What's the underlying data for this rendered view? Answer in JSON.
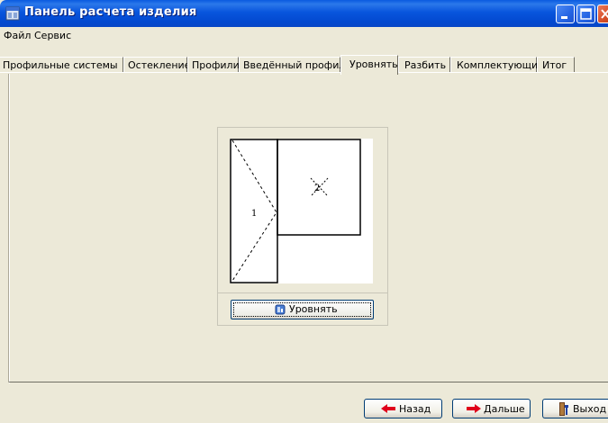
{
  "window": {
    "title": "Панель расчета изделия"
  },
  "menu": {
    "items": [
      {
        "label": "Файл"
      },
      {
        "label": "Сервис"
      }
    ]
  },
  "tabs": {
    "items": [
      {
        "label": "Профильные системы"
      },
      {
        "label": "Остекление"
      },
      {
        "label": "Профили"
      },
      {
        "label": "Введённый профиль"
      },
      {
        "label": "Уровнять",
        "active": true
      },
      {
        "label": "Разбить"
      },
      {
        "label": "Комплектующие"
      },
      {
        "label": "Итог"
      }
    ]
  },
  "drawing": {
    "sash_1_label": "1",
    "sash_2_label": "2"
  },
  "level_button": {
    "label": "Уровнять",
    "icon": "level-icon"
  },
  "footer": {
    "back_label": "Назад",
    "next_label": "Дальше",
    "exit_label": "Выход"
  },
  "colors": {
    "titlebar": "#0a5be0",
    "window_bg": "#ece9d8",
    "arrow_red": "#e0001b"
  }
}
